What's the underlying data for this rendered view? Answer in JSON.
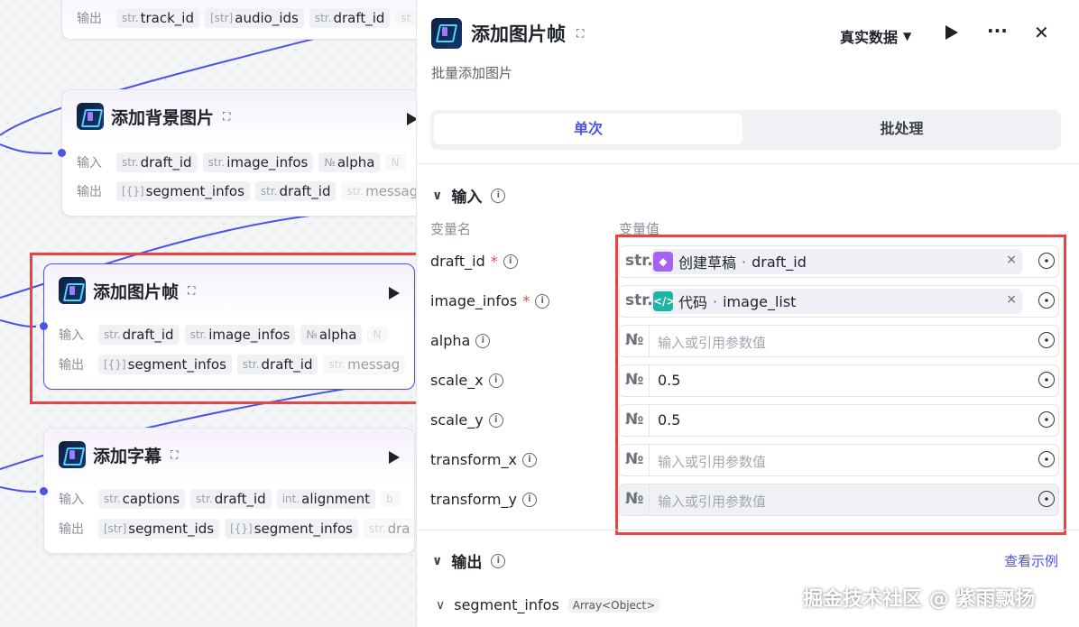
{
  "nodes": {
    "top": {
      "row_label": "输出",
      "tags": [
        {
          "type": "str.",
          "name": "track_id"
        },
        {
          "type": "[str]",
          "name": "audio_ids"
        },
        {
          "type": "str.",
          "name": "draft_id"
        },
        {
          "type": "st",
          "name": ""
        }
      ]
    },
    "bg_image": {
      "title": "添加背景图片",
      "input_label": "输入",
      "output_label": "输出",
      "inputs": [
        {
          "type": "str.",
          "name": "draft_id"
        },
        {
          "type": "str.",
          "name": "image_infos"
        },
        {
          "type": "№",
          "name": "alpha"
        },
        {
          "type": "N",
          "name": ""
        }
      ],
      "outputs": [
        {
          "type": "[{}]",
          "name": "segment_infos"
        },
        {
          "type": "str.",
          "name": "draft_id"
        },
        {
          "type": "str.",
          "name": "messag"
        }
      ]
    },
    "image_frame": {
      "title": "添加图片帧",
      "input_label": "输入",
      "output_label": "输出",
      "inputs": [
        {
          "type": "str.",
          "name": "draft_id"
        },
        {
          "type": "str.",
          "name": "image_infos"
        },
        {
          "type": "№",
          "name": "alpha"
        },
        {
          "type": "N",
          "name": ""
        }
      ],
      "outputs": [
        {
          "type": "[{}]",
          "name": "segment_infos"
        },
        {
          "type": "str.",
          "name": "draft_id"
        },
        {
          "type": "str.",
          "name": "messag"
        }
      ]
    },
    "captions": {
      "title": "添加字幕",
      "input_label": "输入",
      "output_label": "输出",
      "inputs": [
        {
          "type": "str.",
          "name": "captions"
        },
        {
          "type": "str.",
          "name": "draft_id"
        },
        {
          "type": "int.",
          "name": "alignment"
        },
        {
          "type": "b",
          "name": ""
        }
      ],
      "outputs": [
        {
          "type": "[str]",
          "name": "segment_ids"
        },
        {
          "type": "[{}]",
          "name": "segment_infos"
        },
        {
          "type": "str.",
          "name": "dra"
        }
      ]
    }
  },
  "panel": {
    "title": "添加图片帧",
    "description": "批量添加图片",
    "mode": "真实数据",
    "tabs": [
      "单次",
      "批处理"
    ],
    "input_section": "输入",
    "col_name": "变量名",
    "col_value": "变量值",
    "params": [
      {
        "name": "draft_id",
        "required": true,
        "type": "str.",
        "ref_icon": "cube-icon",
        "ref_color": "#a463f2",
        "ref_node": "创建草稿",
        "ref_var": "draft_id"
      },
      {
        "name": "image_infos",
        "required": true,
        "type": "str.",
        "ref_icon": "code-icon",
        "ref_color": "#1fb5a5",
        "ref_node": "代码",
        "ref_var": "image_list"
      },
      {
        "name": "alpha",
        "required": false,
        "type": "№",
        "placeholder": "输入或引用参数值",
        "value": ""
      },
      {
        "name": "scale_x",
        "required": false,
        "type": "№",
        "value": "0.5"
      },
      {
        "name": "scale_y",
        "required": false,
        "type": "№",
        "value": "0.5"
      },
      {
        "name": "transform_x",
        "required": false,
        "type": "№",
        "placeholder": "输入或引用参数值",
        "value": ""
      },
      {
        "name": "transform_y",
        "required": false,
        "type": "№",
        "placeholder": "输入或引用参数值",
        "value": ""
      }
    ],
    "output_section": "输出",
    "view_example": "查看示例",
    "output_var": {
      "name": "segment_infos",
      "type": "Array<Object>"
    }
  },
  "watermark": "掘金技术社区 @ 紫雨飘扬",
  "colors": {
    "accent": "#4d53e8",
    "highlight": "#e64545",
    "wire": "#4d53e8"
  }
}
